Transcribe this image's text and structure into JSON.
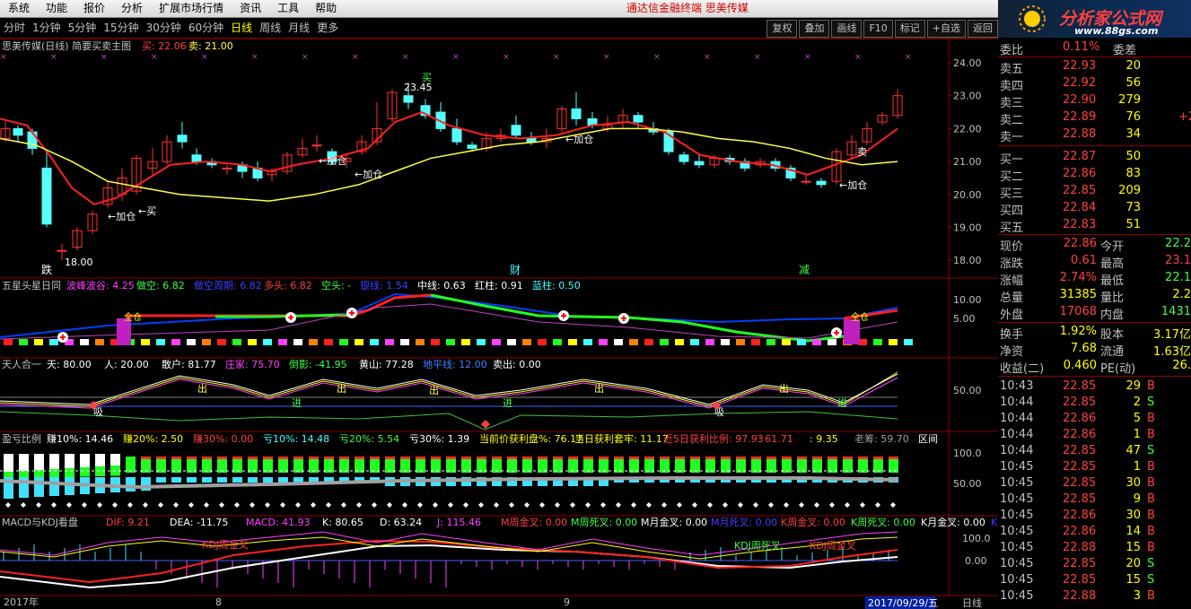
{
  "menu": {
    "items": [
      "系统",
      "功能",
      "报价",
      "分析",
      "扩展市场行情",
      "资讯",
      "工具",
      "帮助"
    ],
    "title": "通达信金融终端  思美传媒"
  },
  "logo": {
    "text": "分析家公式网",
    "url": "www.88gs.com"
  },
  "periods": {
    "items": [
      "分时",
      "1分钟",
      "5分钟",
      "15分钟",
      "30分钟",
      "60分钟",
      "日线",
      "周线",
      "月线",
      "更多"
    ],
    "active": "日线"
  },
  "toolbar": [
    "复权",
    "叠加",
    "画线",
    "F10",
    "标记",
    "+自选",
    "返回"
  ],
  "main": {
    "title": "思美传媒(日线) 简要买卖主图",
    "buy_label": "买: 22.06",
    "sell_label": "卖: 21.00",
    "annotations": [
      "23.45",
      "18.00",
      "买",
      "卖",
      "←加仓",
      "←加仓",
      "←加仓",
      "←加仓",
      "←加仓",
      "←买"
    ],
    "events": [
      "跌",
      "财",
      "减"
    ]
  },
  "axis_main": [
    "24.00",
    "23.00",
    "22.00",
    "21.00",
    "20.00",
    "19.00",
    "18.00"
  ],
  "ind1": {
    "title": "五星头星日同",
    "items": [
      {
        "t": "波峰波谷: 4.25",
        "c": "#ff40ff"
      },
      {
        "t": "做空: 6.82",
        "c": "#40ff40"
      },
      {
        "t": "做空周期: 6.82",
        "c": "#4040ff"
      },
      {
        "t": "多头: 6.82",
        "c": "#ff4040"
      },
      {
        "t": "空头: -",
        "c": "#40ff40"
      },
      {
        "t": "银线: 1.54",
        "c": "#4040ff"
      },
      {
        "t": "中线: 0.63",
        "c": "#ffffff"
      },
      {
        "t": "红柱: 0.91",
        "c": "#ffffff"
      },
      {
        "t": "蓝柱: 0.50",
        "c": "#40ffff"
      }
    ],
    "axis": [
      "10.00",
      "5.00"
    ],
    "labels": [
      "全仓",
      "全仓"
    ]
  },
  "ind2": {
    "title": "天人合一",
    "items": [
      {
        "t": "天: 80.00",
        "c": "#ffffff"
      },
      {
        "t": "人: 20.00",
        "c": "#ffffff"
      },
      {
        "t": "散户: 81.77",
        "c": "#ffffff"
      },
      {
        "t": "庄家: 75.70",
        "c": "#ff40ff"
      },
      {
        "t": "倒影: -41.95",
        "c": "#40ff40"
      },
      {
        "t": "黄山: 77.28",
        "c": "#ffffff"
      },
      {
        "t": "地平线: 12.00",
        "c": "#4080ff"
      },
      {
        "t": "卖出: 0.00",
        "c": "#ffffff"
      }
    ],
    "axis": [
      "50.00"
    ],
    "labels": [
      "出",
      "出",
      "出",
      "出",
      "出",
      "进",
      "进",
      "进",
      "吸",
      "吸"
    ]
  },
  "ind3": {
    "title": "盈亏比例",
    "items": [
      {
        "t": "赚10%: 14.46",
        "c": "#ffffff"
      },
      {
        "t": "赚20%: 2.50",
        "c": "#ffff00"
      },
      {
        "t": "赚30%: 0.00",
        "c": "#ff4040"
      },
      {
        "t": "亏10%: 14.48",
        "c": "#40ffff"
      },
      {
        "t": "亏20%: 5.54",
        "c": "#40ff40"
      },
      {
        "t": "亏30%: 1.39",
        "c": "#ffffff"
      },
      {
        "t": "当前价获利盘%: 76.17",
        "c": "#ffff00"
      },
      {
        "t": "当日获利套牢: 11.17",
        "c": "#ffff00"
      },
      {
        "t": "近5日获利比例: 97.93",
        "c": "#ff4040"
      },
      {
        "t": ": 61.71",
        "c": "#ff4040"
      },
      {
        "t": ": 9.35",
        "c": "#ffff00"
      },
      {
        "t": "老筹: 59.70",
        "c": "#a0a0a0"
      },
      {
        "t": "区间",
        "c": "#ffffff"
      }
    ],
    "axis": [
      "100.0",
      "50.00"
    ]
  },
  "ind4": {
    "title": "MACD与KDJ看盘",
    "items": [
      {
        "t": "DIF: 9.21",
        "c": "#ff4040"
      },
      {
        "t": "DEA: -11.75",
        "c": "#ffffff"
      },
      {
        "t": "MACD: 41.93",
        "c": "#ff40ff"
      },
      {
        "t": "K: 80.65",
        "c": "#ffffff"
      },
      {
        "t": "D: 63.24",
        "c": "#ffffff"
      },
      {
        "t": "J: 115.46",
        "c": "#ff40ff"
      },
      {
        "t": "M周金叉: 0.00",
        "c": "#ff4040"
      },
      {
        "t": "M周死叉: 0.00",
        "c": "#40ff40"
      },
      {
        "t": "M月金叉: 0.00",
        "c": "#ffffff"
      },
      {
        "t": "M月死叉: 0.00",
        "c": "#4040ff"
      },
      {
        "t": "K周金叉: 0.00",
        "c": "#ff4040"
      },
      {
        "t": "K周死叉: 0.00",
        "c": "#40ff40"
      },
      {
        "t": "K月金叉: 0.00",
        "c": "#ffffff"
      },
      {
        "t": "K月",
        "c": "#4040ff"
      }
    ],
    "axis": [
      "100.0",
      "0.00"
    ],
    "labels": [
      "KDJ周金叉",
      "KDJ周死叉",
      "KDJ周金叉"
    ]
  },
  "timeaxis": {
    "labels": [
      "2017年",
      "8",
      "9"
    ],
    "cursor_date": "2017/09/29/五",
    "period": "日线"
  },
  "quote": {
    "weibi": {
      "label": "委比",
      "value": "0.11%",
      "label2": "委差"
    },
    "asks": [
      {
        "l": "卖五",
        "p": "22.93",
        "v": "20"
      },
      {
        "l": "卖四",
        "p": "22.92",
        "v": "56"
      },
      {
        "l": "卖三",
        "p": "22.90",
        "v": "279"
      },
      {
        "l": "卖二",
        "p": "22.89",
        "v": "76",
        "x": "+2"
      },
      {
        "l": "卖一",
        "p": "22.88",
        "v": "34"
      }
    ],
    "bids": [
      {
        "l": "买一",
        "p": "22.87",
        "v": "50"
      },
      {
        "l": "买二",
        "p": "22.86",
        "v": "83"
      },
      {
        "l": "买三",
        "p": "22.85",
        "v": "209"
      },
      {
        "l": "买四",
        "p": "22.84",
        "v": "73"
      },
      {
        "l": "买五",
        "p": "22.83",
        "v": "51"
      }
    ],
    "stats": [
      {
        "l1": "现价",
        "v1": "22.86",
        "c1": "#ff4040",
        "l2": "今开",
        "v2": "22.2",
        "c2": "#40ff40"
      },
      {
        "l1": "涨跌",
        "v1": "0.61",
        "c1": "#ff4040",
        "l2": "最高",
        "v2": "23.1",
        "c2": "#ff4040"
      },
      {
        "l1": "涨幅",
        "v1": "2.74%",
        "c1": "#ff4040",
        "l2": "最低",
        "v2": "22.1",
        "c2": "#40ff40"
      },
      {
        "l1": "总量",
        "v1": "31385",
        "c1": "#ffff00",
        "l2": "量比",
        "v2": "2.2",
        "c2": "#ffff00"
      },
      {
        "l1": "外盘",
        "v1": "17068",
        "c1": "#ff4040",
        "l2": "内盘",
        "v2": "1431",
        "c2": "#40ff40"
      }
    ],
    "stats2": [
      {
        "l1": "换手",
        "v1": "1.92%",
        "c1": "#ffff00",
        "l2": "股本",
        "v2": "3.17亿",
        "c2": "#ffff00"
      },
      {
        "l1": "净资",
        "v1": "7.68",
        "c1": "#ffff00",
        "l2": "流通",
        "v2": "1.63亿",
        "c2": "#ffff00"
      },
      {
        "l1": "收益(二)",
        "v1": "0.460",
        "c1": "#ffff00",
        "l2": "PE(动)",
        "v2": "26.",
        "c2": "#ffff00"
      }
    ],
    "ticks": [
      {
        "t": "10:43",
        "p": "22.85",
        "v": "29",
        "s": "B"
      },
      {
        "t": "10:44",
        "p": "22.85",
        "v": "2",
        "s": "S"
      },
      {
        "t": "10:44",
        "p": "22.86",
        "v": "5",
        "s": "B"
      },
      {
        "t": "10:44",
        "p": "22.86",
        "v": "1",
        "s": "B"
      },
      {
        "t": "10:44",
        "p": "22.85",
        "v": "47",
        "s": "S"
      },
      {
        "t": "10:45",
        "p": "22.85",
        "v": "1",
        "s": "B"
      },
      {
        "t": "10:45",
        "p": "22.85",
        "v": "30",
        "s": "B"
      },
      {
        "t": "10:45",
        "p": "22.85",
        "v": "9",
        "s": "B"
      },
      {
        "t": "10:45",
        "p": "22.86",
        "v": "30",
        "s": "B"
      },
      {
        "t": "10:45",
        "p": "22.86",
        "v": "14",
        "s": "B"
      },
      {
        "t": "10:45",
        "p": "22.88",
        "v": "15",
        "s": "B"
      },
      {
        "t": "10:45",
        "p": "22.85",
        "v": "20",
        "s": "S"
      },
      {
        "t": "10:45",
        "p": "22.85",
        "v": "15",
        "s": "S"
      },
      {
        "t": "10:45",
        "p": "22.88",
        "v": "3",
        "s": "B"
      }
    ]
  },
  "colors": {
    "up": "#ff3232",
    "down": "#54ffff",
    "ma_fast": "#ff2020",
    "ma_slow": "#ffff40"
  }
}
